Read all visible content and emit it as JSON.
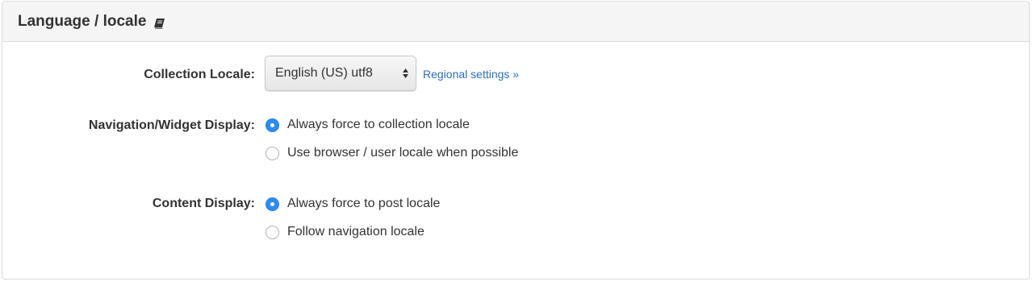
{
  "panel": {
    "title": "Language / locale",
    "title_icon": "book-icon"
  },
  "collection_locale": {
    "label": "Collection Locale:",
    "selected": "English (US) utf8",
    "link_text": "Regional settings »"
  },
  "navigation_display": {
    "label": "Navigation/Widget Display:",
    "options": [
      {
        "label": "Always force to collection locale",
        "checked": true
      },
      {
        "label": "Use browser / user locale when possible",
        "checked": false
      }
    ]
  },
  "content_display": {
    "label": "Content Display:",
    "options": [
      {
        "label": "Always force to post locale",
        "checked": true
      },
      {
        "label": "Follow navigation locale",
        "checked": false
      }
    ]
  },
  "colors": {
    "accent": "#2d8cf0",
    "link": "#2a6fb5",
    "heading_bg": "#f5f5f5"
  }
}
